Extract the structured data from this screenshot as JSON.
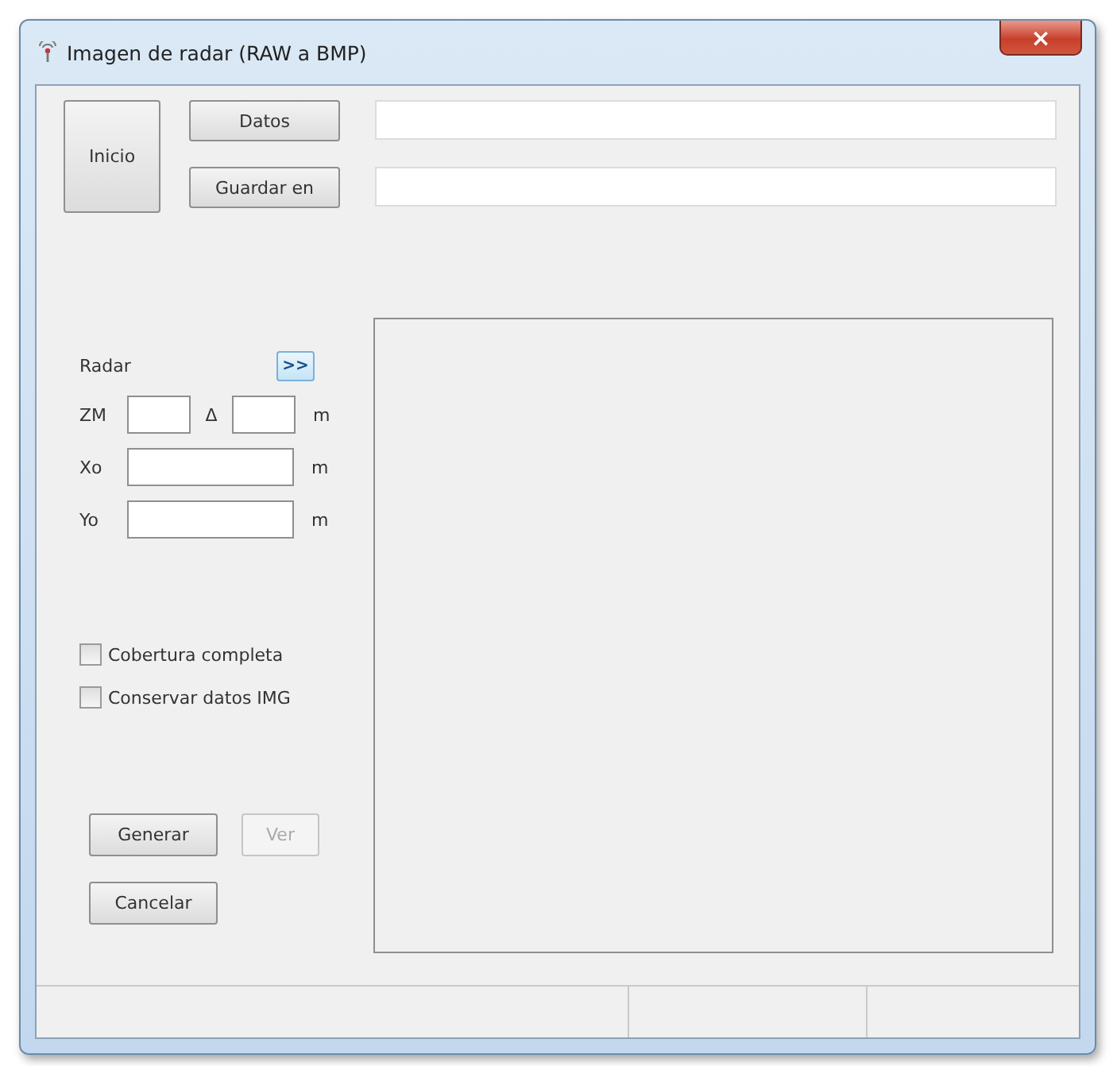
{
  "window": {
    "title": "Imagen de radar (RAW a BMP)",
    "close": "×"
  },
  "start_button": {
    "label": "Inicio"
  },
  "path_rows": [
    {
      "button": "Datos"
    },
    {
      "button": "Guardar en"
    }
  ],
  "radar": {
    "label": "Radar",
    "expand_button": ">>",
    "rows": [
      {
        "label": "ZM",
        "second_label": "Δ",
        "unit": "m"
      },
      {
        "label": "Xo",
        "unit": "m"
      },
      {
        "label": "Yo",
        "unit": "m"
      }
    ]
  },
  "options": [
    {
      "label": "Cobertura completa",
      "checked": false
    },
    {
      "label": "Conservar datos IMG",
      "checked": false
    }
  ],
  "actions": [
    {
      "label": "Generar",
      "disabled": false
    },
    {
      "label": "Ver",
      "disabled": true
    },
    {
      "label": "Cancelar",
      "disabled": false
    }
  ]
}
